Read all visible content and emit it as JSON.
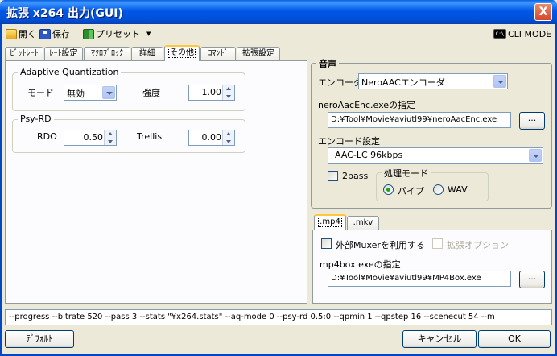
{
  "window": {
    "title": "拡張 x264 出力(GUI)",
    "close_glyph": "X"
  },
  "toolbar": {
    "open": "開く",
    "save": "保存",
    "preset": "プリセット",
    "preset_arrow": "▼",
    "cli_mode": "CLI MODE",
    "cli_icon_text": "C:\\"
  },
  "tabs": [
    "ﾋﾞｯﾄﾚｰﾄ",
    "ﾚｰﾄ設定",
    "ﾏｸﾛﾌﾞﾛｯｸ",
    "詳細",
    "その他",
    "ｺﾏﾝﾄﾞ",
    "拡張設定"
  ],
  "adaptive_quantization": {
    "title": "Adaptive Quantization",
    "mode_label": "モード",
    "mode_value": "無効",
    "strength_label": "強度",
    "strength_value": "1.00"
  },
  "psy_rd": {
    "title": "Psy-RD",
    "rdo_label": "RDO",
    "rdo_value": "0.50",
    "trellis_label": "Trellis",
    "trellis_value": "0.00"
  },
  "audio": {
    "title": "音声",
    "encoder_label": "エンコーダ",
    "encoder_value": "NeroAACエンコーダ",
    "exe_label": "neroAacEnc.exeの指定",
    "exe_path": "D:¥Tool¥Movie¥aviutl99¥neroAacEnc.exe",
    "browse": "...",
    "settings_label": "エンコード設定",
    "settings_value": "AAC-LC 96kbps",
    "twopass_label": "2pass",
    "mode_group_title": "処理モード",
    "mode_pipe": "パイプ",
    "mode_wav": "WAV"
  },
  "muxer": {
    "tabs": [
      ".mp4",
      ".mkv"
    ],
    "external_muxer_label": "外部Muxerを利用する",
    "ext_option_label": "拡張オプション",
    "exe_label": "mp4box.exeの指定",
    "exe_path": "D:¥Tool¥Movie¥aviutl99¥MP4Box.exe",
    "browse": "..."
  },
  "cmdline": "--progress --bitrate 520 --pass 3 --stats \"¥x264.stats\" --aq-mode 0 --psy-rd 0.5:0 --qpmin 1 --qpstep 16 --scenecut 54 --m",
  "buttons": {
    "default": "ﾃﾞﾌｫﾙﾄ",
    "cancel": "キャンセル",
    "ok": "OK"
  }
}
